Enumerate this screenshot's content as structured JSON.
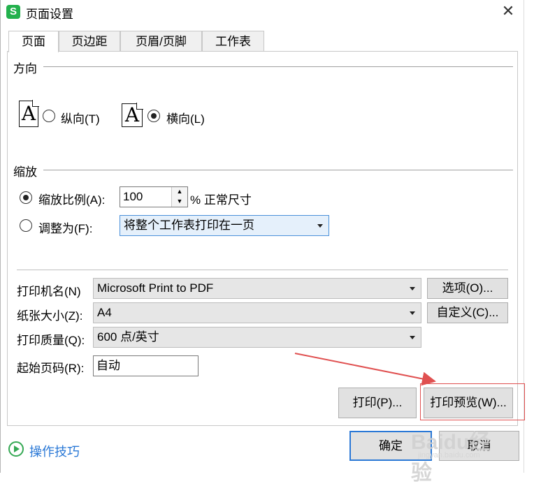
{
  "window": {
    "title": "页面设置",
    "app_icon": "wps-spreadsheet-icon",
    "close": "✕"
  },
  "tabs": [
    {
      "label": "页面",
      "active": true
    },
    {
      "label": "页边距"
    },
    {
      "label": "页眉/页脚"
    },
    {
      "label": "工作表"
    }
  ],
  "orientation": {
    "section_label": "方向",
    "portrait": {
      "icon_letter": "A",
      "label": "纵向(T)",
      "selected": false
    },
    "landscape": {
      "icon_letter": "A",
      "label": "横向(L)",
      "selected": true
    }
  },
  "scaling": {
    "section_label": "缩放",
    "scale_option": {
      "label": "缩放比例(A):",
      "selected": true,
      "value": "100",
      "suffix": "% 正常尺寸"
    },
    "fit_option": {
      "label": "调整为(F):",
      "selected": false,
      "value": "将整个工作表打印在一页"
    }
  },
  "printer": {
    "name": {
      "label": "打印机名(N)",
      "value": "Microsoft Print to PDF",
      "button": "选项(O)..."
    },
    "paper": {
      "label": "纸张大小(Z):",
      "value": "A4",
      "button": "自定义(C)..."
    },
    "quality": {
      "label": "打印质量(Q):",
      "value": "600 点/英寸"
    },
    "start_page": {
      "label": "起始页码(R):",
      "value": "自动"
    }
  },
  "buttons": {
    "print": "打印(P)...",
    "preview": "打印预览(W)...",
    "ok": "确定",
    "cancel": "取消"
  },
  "help": {
    "label": "操作技巧"
  },
  "watermark": {
    "text": "Baidu经验",
    "sub": "jingyan.baidu.com"
  },
  "colors": {
    "annotation": "#e05050",
    "accent": "#2a78d6",
    "app": "#23b14d"
  }
}
